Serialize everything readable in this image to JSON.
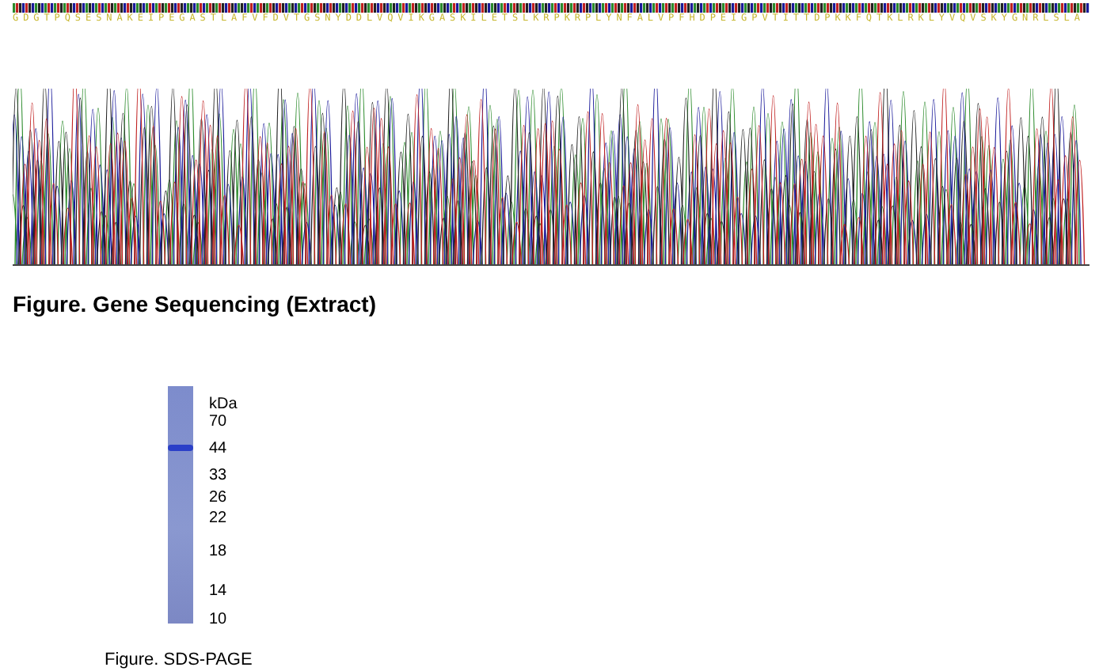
{
  "sequencing": {
    "protein_sequence": "GDGTPQSESNAKEIPEGASTLAFVFDVTGSNYDDLVQVIKGASKILETSLKRPKRPLYNFALVPFHDPEIGPVTITTDPKKFQTKLRKLYVQVSKYGNRLSLA",
    "caption": "Figure. Gene Sequencing (Extract)"
  },
  "gel": {
    "unit": "kDa",
    "markers": [
      "70",
      "44",
      "33",
      "26",
      "22",
      "18",
      "14",
      "10"
    ],
    "caption": "Figure. SDS-PAGE"
  }
}
